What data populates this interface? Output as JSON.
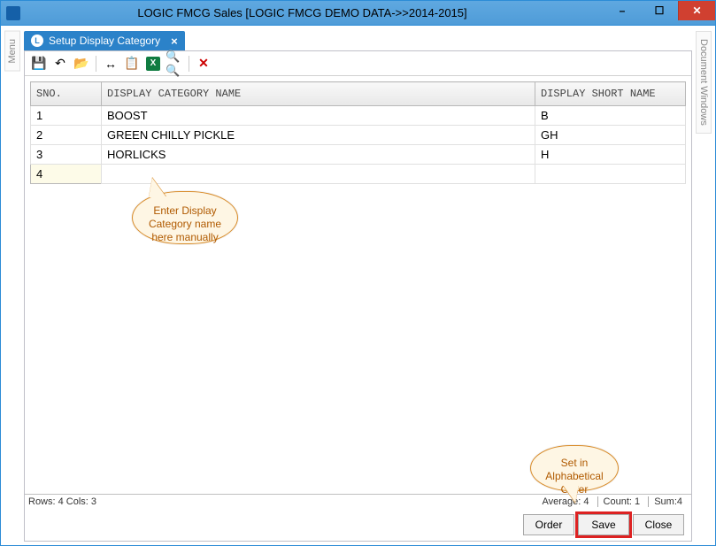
{
  "window": {
    "title": "LOGIC FMCG Sales  [LOGIC FMCG DEMO DATA->>2014-2015]"
  },
  "side_tabs": {
    "left": "Menu",
    "right": "Document Windows"
  },
  "doc_tab": {
    "label": "Setup Display Category"
  },
  "toolbar_icons": {
    "save": "save-icon",
    "undo": "undo-icon",
    "open": "open-icon",
    "width": "column-width-icon",
    "copy": "copy-icon",
    "excel": "excel-icon",
    "find": "find-icon",
    "delete": "delete-icon"
  },
  "grid": {
    "columns": [
      {
        "key": "sno",
        "header": "SNO."
      },
      {
        "key": "name",
        "header": "DISPLAY CATEGORY NAME"
      },
      {
        "key": "short",
        "header": "DISPLAY SHORT NAME"
      }
    ],
    "rows": [
      {
        "sno": "1",
        "name": "BOOST",
        "short": "B"
      },
      {
        "sno": "2",
        "name": "GREEN CHILLY PICKLE",
        "short": "GH"
      },
      {
        "sno": "3",
        "name": "HORLICKS",
        "short": "H"
      },
      {
        "sno": "4",
        "name": "",
        "short": ""
      }
    ]
  },
  "status": {
    "left": "Rows: 4  Cols: 3",
    "avg": "Average: 4",
    "count": "Count: 1",
    "sum": "Sum:4"
  },
  "buttons": {
    "order": "Order",
    "save": "Save",
    "close": "Close"
  },
  "callouts": {
    "c1": "Enter Display Category name here manually",
    "c2": "Set in Alphabetical Order"
  }
}
